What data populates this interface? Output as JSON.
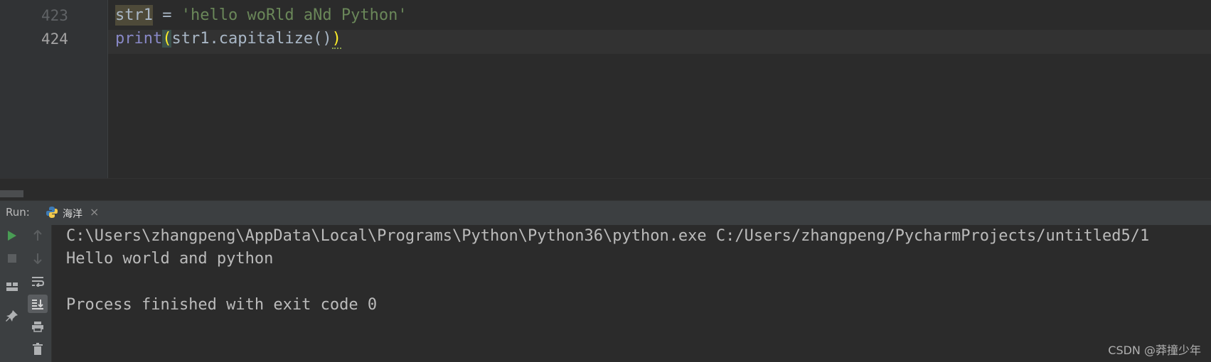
{
  "editor": {
    "lines": [
      {
        "number": "423",
        "var": "str1",
        "op": " = ",
        "string": "'hello woRld aNd Python'"
      },
      {
        "number": "424",
        "builtin": "print",
        "open_paren": "(",
        "args": "str1.capitalize()",
        "close_paren": ")"
      }
    ]
  },
  "run_panel": {
    "label": "Run:",
    "tab_label": "海洋",
    "tab_close": "×",
    "tab_icon": "python-icon",
    "toolbar_icons": [
      "run-icon",
      "up-arrow-icon",
      "stop-icon",
      "down-arrow-icon",
      "layout-icon",
      "soft-wrap-icon",
      "scroll-to-end-icon",
      "pin-icon",
      "print-icon",
      "delete-icon"
    ],
    "console": [
      "C:\\Users\\zhangpeng\\AppData\\Local\\Programs\\Python\\Python36\\python.exe C:/Users/zhangpeng/PycharmProjects/untitled5/1",
      "Hello world and python",
      "",
      "Process finished with exit code 0"
    ]
  },
  "watermark": "CSDN @莽撞少年",
  "colors": {
    "background": "#2b2b2b",
    "string": "#6a8759",
    "builtin": "#8888c6",
    "bracket_match": "#ffef28",
    "run_green": "#499c54"
  }
}
